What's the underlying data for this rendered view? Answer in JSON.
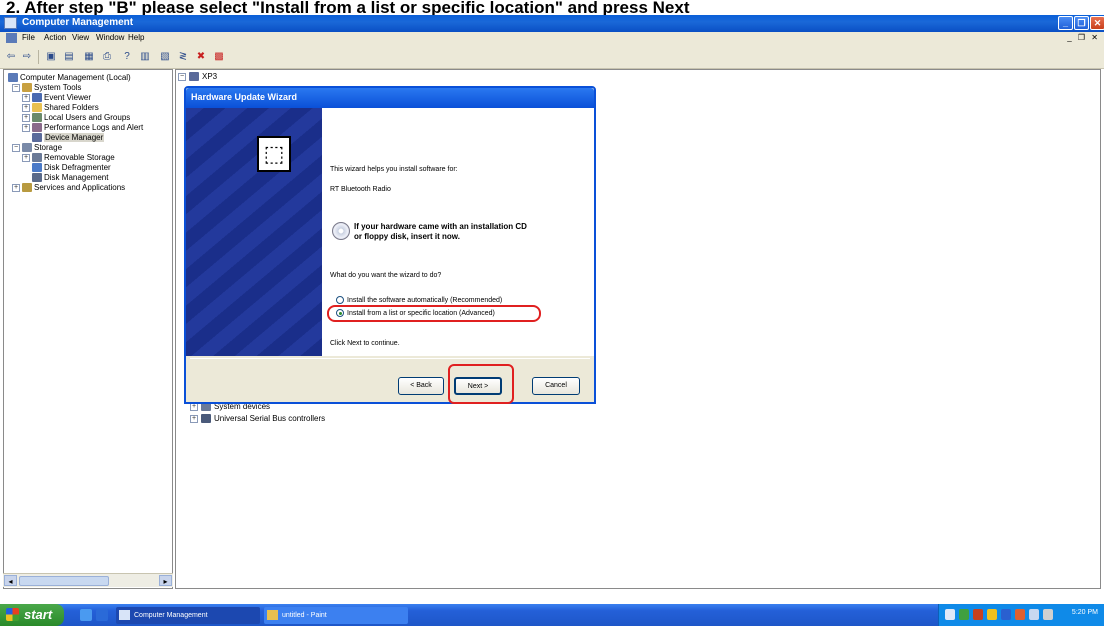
{
  "caption": "2.  After step \"B\" please select \"Install from a list or specific location\" and press Next",
  "window": {
    "title": "Computer Management",
    "buttons": [
      "_",
      "❐",
      "✕"
    ]
  },
  "menu": {
    "items": [
      "File",
      "Action",
      "View",
      "Window",
      "Help"
    ],
    "mdi_buttons": "_ ❐ ✕"
  },
  "tree": {
    "items": [
      {
        "label": "Computer Management (Local)",
        "icon": "computer-icon"
      },
      {
        "label": "System Tools",
        "icon": "tools-icon"
      },
      {
        "label": "Event Viewer",
        "icon": "event-viewer-icon"
      },
      {
        "label": "Shared Folders",
        "icon": "folder-icon"
      },
      {
        "label": "Local Users and Groups",
        "icon": "users-icon"
      },
      {
        "label": "Performance Logs and Alert",
        "icon": "performance-icon"
      },
      {
        "label": "Device Manager",
        "icon": "device-manager-icon"
      },
      {
        "label": "Storage",
        "icon": "storage-icon"
      },
      {
        "label": "Removable Storage",
        "icon": "removable-storage-icon"
      },
      {
        "label": "Disk Defragmenter",
        "icon": "defrag-icon"
      },
      {
        "label": "Disk Management",
        "icon": "disk-icon"
      },
      {
        "label": "Services and Applications",
        "icon": "services-icon"
      }
    ]
  },
  "right_pane": {
    "root": "XP3",
    "items": [
      "System devices",
      "Universal Serial Bus controllers"
    ]
  },
  "wizard": {
    "title": "Hardware Update Wizard",
    "intro": "This wizard helps you install software for:",
    "device": "RT Bluetooth Radio",
    "cd_line1": "If your hardware came with an installation CD",
    "cd_line2": "or floppy disk, insert it now.",
    "question": "What do you want the wizard to do?",
    "options": [
      {
        "label": "Install the software automatically (Recommended)",
        "selected": false
      },
      {
        "label": "Install from a list or specific location (Advanced)",
        "selected": true
      }
    ],
    "continue": "Click Next to continue.",
    "back": "< Back",
    "next": "Next >",
    "cancel": "Cancel"
  },
  "taskbar": {
    "start": "start",
    "tasks": [
      "Computer Management",
      "untitled - Paint"
    ],
    "clock": "5:20 PM"
  },
  "colors": {
    "title_blue": "#0a50d8",
    "taskbar_blue": "#2460d8",
    "start_green": "#2a8a2a",
    "annotation_red": "#e02020"
  }
}
